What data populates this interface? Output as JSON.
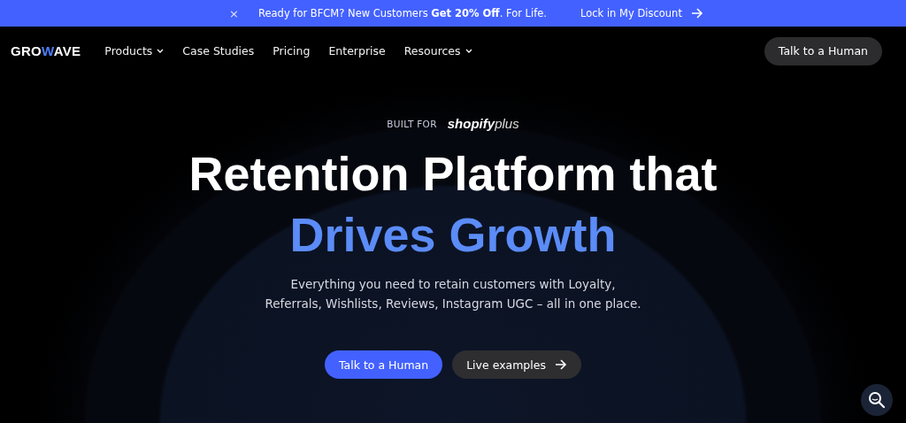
{
  "announcement": {
    "close": "×",
    "message": "Ready for BFCM? New Customers **Get 20% Off**. For Life.",
    "link": "Lock in My Discount"
  },
  "nav": {
    "logo": [
      {
        "text": "GRO",
        "accent": false
      },
      {
        "text": "W",
        "accent": true
      },
      {
        "text": "AVE",
        "accent": false
      }
    ],
    "items": [
      {
        "label": "Products",
        "has_menu": true
      },
      {
        "label": "Case Studies",
        "has_menu": false
      },
      {
        "label": "Pricing",
        "has_menu": false
      },
      {
        "label": "Enterprise",
        "has_menu": false
      },
      {
        "label": "Resources",
        "has_menu": true
      }
    ],
    "cta": "Talk to a Human"
  },
  "hero": {
    "built_for": "BUILT FOR",
    "platform": [
      {
        "text": "shopify",
        "kind": "bold"
      },
      {
        "text": "plus",
        "kind": "light"
      }
    ],
    "headline": [
      {
        "text": "Retention Platform that",
        "accent": false
      },
      {
        "text": "Drives Growth",
        "accent": true
      }
    ],
    "subtitle": "Everything you need to retain customers with Loyalty, Referrals, Wishlists, Reviews, Instagram UGC – all in one place.",
    "buttons": [
      {
        "label": "Talk to a Human",
        "kind": "primary"
      },
      {
        "label": "Live examples",
        "kind": "secondary"
      }
    ]
  }
}
